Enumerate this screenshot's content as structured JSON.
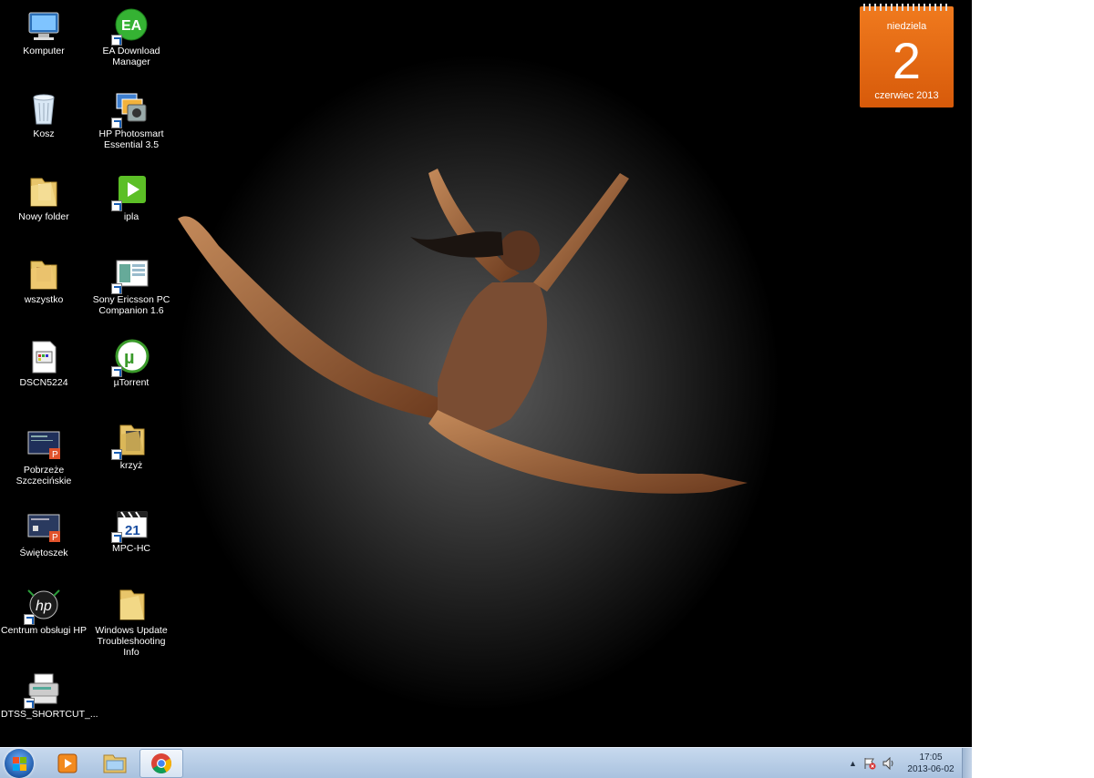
{
  "desktop": {
    "icons_col1": [
      {
        "label": "Komputer",
        "icon": "computer-icon",
        "shortcut": false
      },
      {
        "label": "Kosz",
        "icon": "recycle-bin-icon",
        "shortcut": false
      },
      {
        "label": "Nowy folder",
        "icon": "folder-icon",
        "shortcut": false
      },
      {
        "label": "wszystko",
        "icon": "folder-icon",
        "shortcut": false
      },
      {
        "label": "DSCN5224",
        "icon": "image-file-icon",
        "shortcut": false
      },
      {
        "label": "Pobrzeże Szczecińskie",
        "icon": "powerpoint-file-icon",
        "shortcut": false
      },
      {
        "label": "Świętoszek",
        "icon": "powerpoint-file-icon",
        "shortcut": false
      },
      {
        "label": "Centrum obsługi HP",
        "icon": "hp-icon",
        "shortcut": true
      },
      {
        "label": "DTSS_SHORTCUT_...",
        "icon": "printer-icon",
        "shortcut": true
      }
    ],
    "icons_col2": [
      {
        "label": "EA Download Manager",
        "icon": "ea-icon",
        "shortcut": true
      },
      {
        "label": "HP Photosmart Essential 3.5",
        "icon": "photosmart-icon",
        "shortcut": true
      },
      {
        "label": "ipla",
        "icon": "ipla-play-icon",
        "shortcut": true
      },
      {
        "label": "Sony Ericsson PC Companion 1.6",
        "icon": "pc-companion-icon",
        "shortcut": true
      },
      {
        "label": "µTorrent",
        "icon": "utorrent-icon",
        "shortcut": true
      },
      {
        "label": "krzyż",
        "icon": "folder-icon",
        "shortcut": true
      },
      {
        "label": "MPC-HC",
        "icon": "mpc-hc-icon",
        "shortcut": true
      },
      {
        "label": "Windows Update Troubleshooting Info",
        "icon": "folder-icon",
        "shortcut": false
      }
    ]
  },
  "calendar": {
    "weekday": "niedziela",
    "day": "2",
    "month_year": "czerwiec 2013"
  },
  "taskbar": {
    "pinned": [
      {
        "name": "media-player-icon"
      },
      {
        "name": "explorer-icon"
      },
      {
        "name": "chrome-icon",
        "active": true
      }
    ],
    "clock_time": "17:05",
    "clock_date": "2013-06-02"
  }
}
